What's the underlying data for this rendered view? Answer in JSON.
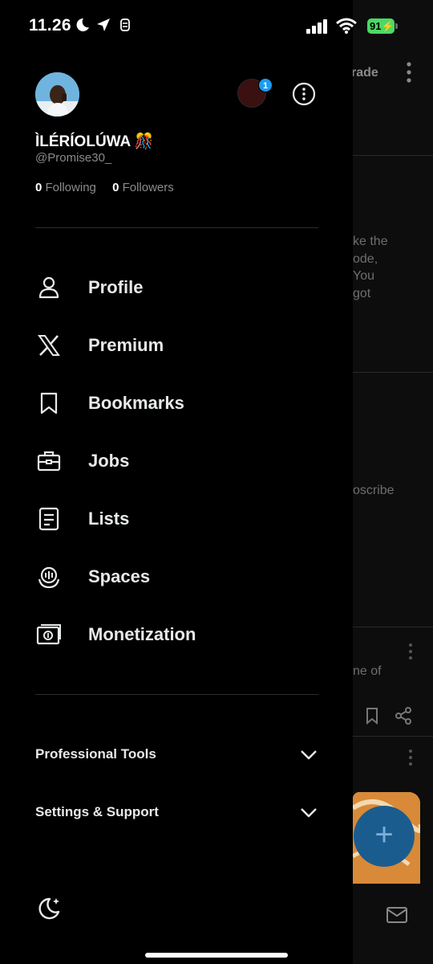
{
  "status_bar": {
    "time": "11.26",
    "battery": "91"
  },
  "profile": {
    "display_name": "ÌLÉRÍOLÚWA 🎊",
    "handle": "@Promise30_",
    "following_count": "0",
    "following_label": "Following",
    "followers_count": "0",
    "followers_label": "Followers",
    "notification_count": "1"
  },
  "menu": [
    {
      "label": "Profile",
      "icon": "person-icon"
    },
    {
      "label": "Premium",
      "icon": "x-logo-icon"
    },
    {
      "label": "Bookmarks",
      "icon": "bookmark-icon"
    },
    {
      "label": "Jobs",
      "icon": "briefcase-icon"
    },
    {
      "label": "Lists",
      "icon": "list-icon"
    },
    {
      "label": "Spaces",
      "icon": "spaces-icon"
    },
    {
      "label": "Monetization",
      "icon": "money-icon"
    }
  ],
  "sections": {
    "professional_tools": "Professional Tools",
    "settings_support": "Settings & Support"
  },
  "background": {
    "header_fragment": "rade",
    "tweet_lines": [
      "ke the",
      "ode,",
      "You",
      "got"
    ],
    "subscribe_fragment": "oscribe",
    "other_fragment": "ne of"
  },
  "colors": {
    "accent": "#1d9bf0",
    "battery": "#4cd964",
    "fab": "#1b5c8f"
  }
}
